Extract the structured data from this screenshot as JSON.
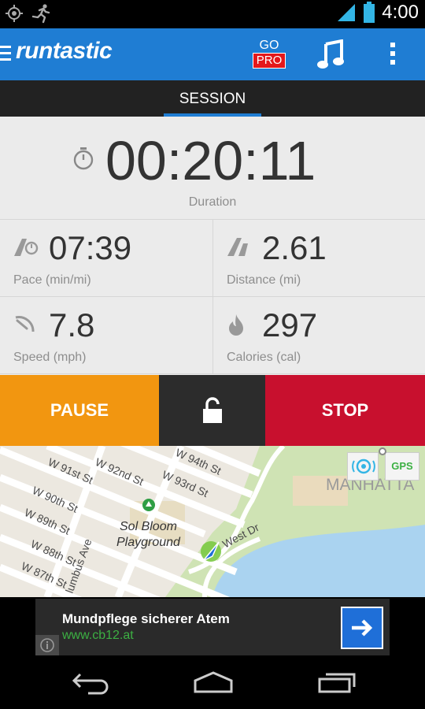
{
  "status_bar": {
    "time": "4:00",
    "icons": [
      "gps-target-icon",
      "runner-icon",
      "signal-icon",
      "battery-icon"
    ]
  },
  "action_bar": {
    "app_name": "runtastic",
    "go_label": "GO",
    "pro_label": "PRO",
    "icons": [
      "menu-icon",
      "music-icon",
      "overflow-icon"
    ]
  },
  "tabs": [
    {
      "label": "SESSION",
      "active": true
    }
  ],
  "stats": {
    "duration": {
      "value": "00:20:11",
      "label": "Duration"
    },
    "pace": {
      "value": "07:39",
      "label": "Pace (min/mi)"
    },
    "distance": {
      "value": "2.61",
      "label": "Distance (mi)"
    },
    "speed": {
      "value": "7.8",
      "label": "Speed (mph)"
    },
    "calories": {
      "value": "297",
      "label": "Calories (cal)"
    }
  },
  "controls": {
    "pause_label": "PAUSE",
    "stop_label": "STOP"
  },
  "map": {
    "labels": [
      "W 94th St",
      "W 93rd St",
      "W 92nd St",
      "W 91st St",
      "W 90th St",
      "W 89th St",
      "W 88th St",
      "W 87th St",
      "Sol Bloom",
      "Playground",
      "West Dr",
      "lumbus Ave",
      "MANHATTA"
    ],
    "gps_label": "GPS"
  },
  "ad": {
    "title": "Mundpflege sicherer Atem",
    "url": "www.cb12.at"
  },
  "colors": {
    "brand_blue": "#1f7dd3",
    "pause_orange": "#f29610",
    "stop_red": "#c8102e",
    "lock_dark": "#2c2c2c",
    "status_icon_blue": "#33b5e5",
    "ad_green": "#3cb043"
  }
}
